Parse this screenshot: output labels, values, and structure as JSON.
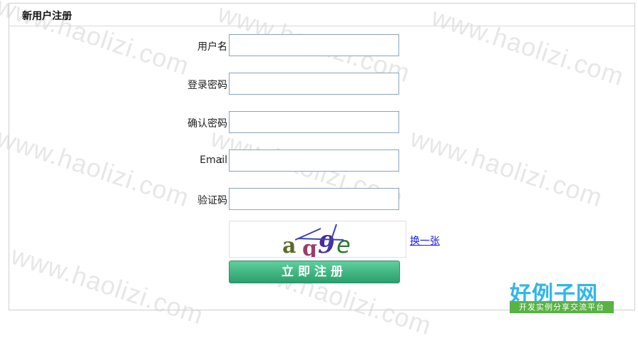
{
  "watermark": "www.haolizi.com",
  "panel": {
    "title": "新用户注册"
  },
  "form": {
    "username_label": "用户名",
    "password_label": "登录密码",
    "confirm_label": "确认密码",
    "email_label": "Email",
    "captcha_label": "验证码",
    "colon": ":",
    "username_value": "",
    "password_value": "",
    "confirm_value": "",
    "email_value": "",
    "captcha_value": ""
  },
  "captcha": {
    "text": "ag9e",
    "refresh_label": "换一张"
  },
  "submit_label": "立即注册",
  "logo": {
    "title": "好例子网",
    "subtitle": "开发实例分享交流平台"
  }
}
